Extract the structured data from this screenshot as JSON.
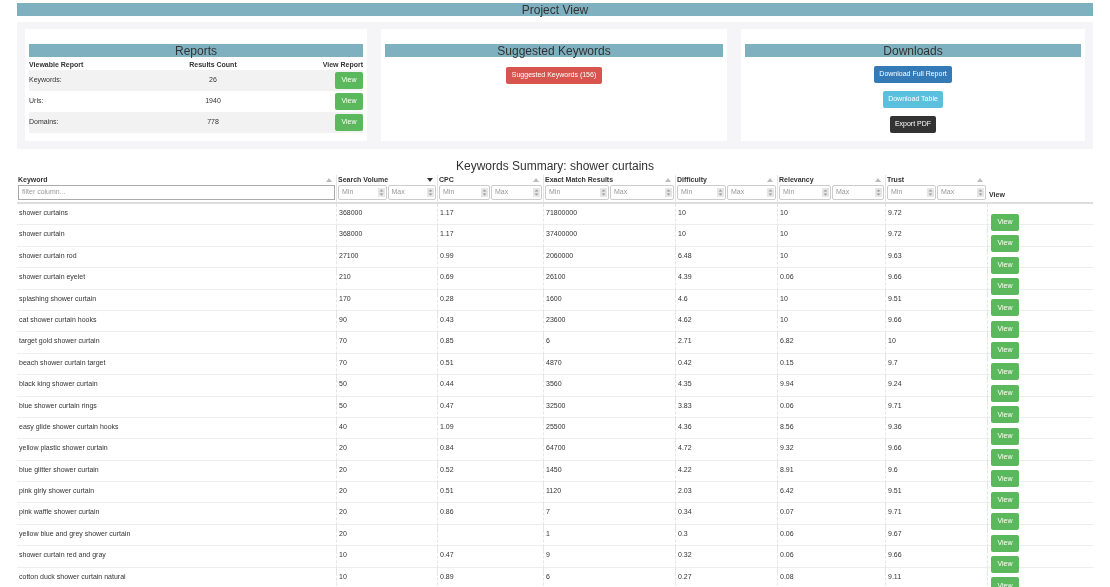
{
  "page_title": "Project View",
  "reports": {
    "title": "Reports",
    "columns": [
      "Viewable Report",
      "Results Count",
      "View Report"
    ],
    "rows": [
      {
        "name": "Keywords:",
        "count": "26",
        "button": "View"
      },
      {
        "name": "Urls:",
        "count": "1940",
        "button": "View"
      },
      {
        "name": "Domains:",
        "count": "778",
        "button": "View"
      }
    ]
  },
  "suggested": {
    "title": "Suggested Keywords",
    "button": "Suggested Keywords (156)"
  },
  "downloads": {
    "title": "Downloads",
    "buttons": [
      {
        "label": "Download Full Report",
        "kind": "primary"
      },
      {
        "label": "Download Table",
        "kind": "info"
      },
      {
        "label": "Export PDF",
        "kind": "dark"
      }
    ]
  },
  "summary": {
    "title": "Keywords Summary: shower curtains",
    "columns": [
      {
        "label": "Keyword",
        "sorted": false,
        "filter": {
          "kind": "text",
          "placeholder": "filter column..."
        }
      },
      {
        "label": "Search Volume",
        "sorted": true,
        "filter": {
          "kind": "range",
          "min_placeholder": "Min",
          "max_placeholder": "Max"
        }
      },
      {
        "label": "CPC",
        "sorted": false,
        "filter": {
          "kind": "range",
          "min_placeholder": "Min",
          "max_placeholder": "Max"
        }
      },
      {
        "label": "Exact Match Results",
        "sorted": false,
        "filter": {
          "kind": "range",
          "min_placeholder": "Min",
          "max_placeholder": "Max"
        }
      },
      {
        "label": "Difficulty",
        "sorted": false,
        "filter": {
          "kind": "range",
          "min_placeholder": "Min",
          "max_placeholder": "Max"
        }
      },
      {
        "label": "Relevancy",
        "sorted": false,
        "filter": {
          "kind": "range",
          "min_placeholder": "Min",
          "max_placeholder": "Max"
        }
      },
      {
        "label": "Trust",
        "sorted": false,
        "filter": {
          "kind": "range",
          "min_placeholder": "Min",
          "max_placeholder": "Max"
        }
      },
      {
        "label": "View"
      }
    ],
    "rows": [
      {
        "cells": [
          "shower curtains",
          "368000",
          "1.17",
          "71800000",
          "10",
          "10",
          "9.72"
        ],
        "button": "View"
      },
      {
        "cells": [
          "shower curtain",
          "368000",
          "1.17",
          "37400000",
          "10",
          "10",
          "9.72"
        ],
        "button": "View"
      },
      {
        "cells": [
          "shower curtain rod",
          "27100",
          "0.99",
          "2060000",
          "6.48",
          "10",
          "9.63"
        ],
        "button": "View"
      },
      {
        "cells": [
          "shower curtain eyelet",
          "210",
          "0.69",
          "26100",
          "4.39",
          "0.06",
          "9.66"
        ],
        "button": "View"
      },
      {
        "cells": [
          "splashing shower curtain",
          "170",
          "0.28",
          "1600",
          "4.6",
          "10",
          "9.51"
        ],
        "button": "View"
      },
      {
        "cells": [
          "cat shower curtain hooks",
          "90",
          "0.43",
          "23600",
          "4.62",
          "10",
          "9.66"
        ],
        "button": "View"
      },
      {
        "cells": [
          "target gold shower curtain",
          "70",
          "0.85",
          "6",
          "2.71",
          "6.82",
          "10"
        ],
        "button": "View"
      },
      {
        "cells": [
          "beach shower curtain target",
          "70",
          "0.51",
          "4870",
          "0.42",
          "0.15",
          "9.7"
        ],
        "button": "View"
      },
      {
        "cells": [
          "black king shower curtain",
          "50",
          "0.44",
          "3560",
          "4.35",
          "9.94",
          "9.24"
        ],
        "button": "View"
      },
      {
        "cells": [
          "blue shower curtain rings",
          "50",
          "0.47",
          "32500",
          "3.83",
          "0.06",
          "9.71"
        ],
        "button": "View"
      },
      {
        "cells": [
          "easy glide shower curtain hooks",
          "40",
          "1.09",
          "25500",
          "4.36",
          "8.56",
          "9.36"
        ],
        "button": "View"
      },
      {
        "cells": [
          "yellow plastic shower curtain",
          "20",
          "0.84",
          "64700",
          "4.72",
          "9.32",
          "9.66"
        ],
        "button": "View"
      },
      {
        "cells": [
          "blue glitter shower curtain",
          "20",
          "0.52",
          "1450",
          "4.22",
          "8.91",
          "9.6"
        ],
        "button": "View"
      },
      {
        "cells": [
          "pink girly shower curtain",
          "20",
          "0.51",
          "1120",
          "2.03",
          "6.42",
          "9.51"
        ],
        "button": "View"
      },
      {
        "cells": [
          "pink waffle shower curtain",
          "20",
          "0.86",
          "7",
          "0.34",
          "0.07",
          "9.71"
        ],
        "button": "View"
      },
      {
        "cells": [
          "yellow blue and grey shower curtain",
          "20",
          null,
          "1",
          "0.3",
          "0.06",
          "9.67"
        ],
        "button": "View"
      },
      {
        "cells": [
          "shower curtain red and gray",
          "10",
          "0.47",
          "9",
          "0.32",
          "0.06",
          "9.66"
        ],
        "button": "View"
      },
      {
        "cells": [
          "cotton duck shower curtain natural",
          "10",
          "0.89",
          "6",
          "0.27",
          "0.08",
          "9.11"
        ],
        "button": "View"
      }
    ]
  }
}
